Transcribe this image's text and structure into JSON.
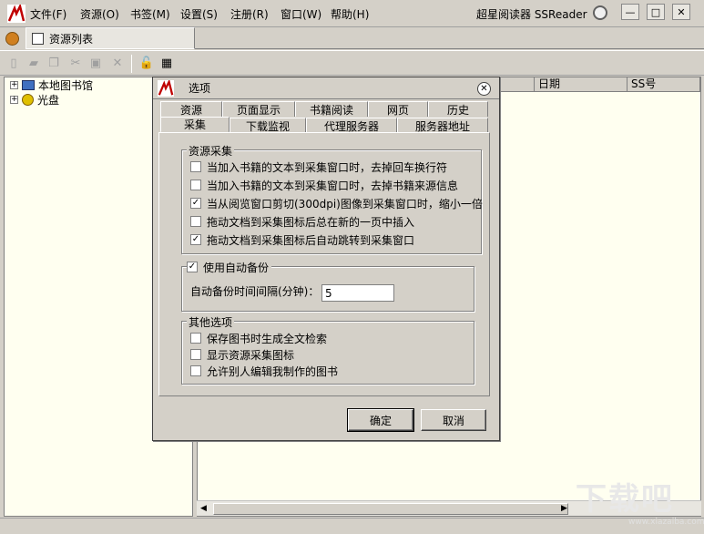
{
  "menubar": {
    "items": [
      {
        "label": "文件(F)"
      },
      {
        "label": "资源(O)"
      },
      {
        "label": "书签(M)"
      },
      {
        "label": "设置(S)"
      },
      {
        "label": "注册(R)"
      },
      {
        "label": "窗口(W)"
      },
      {
        "label": "帮助(H)"
      }
    ],
    "app_title": "超星阅读器 SSReader"
  },
  "doc_tab": {
    "label": "资源列表"
  },
  "tree": {
    "items": [
      {
        "label": "本地图书馆"
      },
      {
        "label": "光盘"
      }
    ]
  },
  "list": {
    "columns": [
      {
        "label": "日期"
      },
      {
        "label": "SS号"
      }
    ]
  },
  "dialog": {
    "title": "选项",
    "tabs_row1": [
      {
        "label": "资源"
      },
      {
        "label": "页面显示"
      },
      {
        "label": "书籍阅读"
      },
      {
        "label": "网页"
      },
      {
        "label": "历史"
      }
    ],
    "tabs_row2": [
      {
        "label": "采集"
      },
      {
        "label": "下载监视"
      },
      {
        "label": "代理服务器"
      },
      {
        "label": "服务器地址"
      }
    ],
    "group_collect": {
      "title": "资源采集",
      "options": [
        {
          "label": "当加入书籍的文本到采集窗口时，去掉回车换行符",
          "checked": "false"
        },
        {
          "label": "当加入书籍的文本到采集窗口时，去掉书籍来源信息",
          "checked": "false"
        },
        {
          "label": "当从阅览窗口剪切(300dpi)图像到采集窗口时，缩小一倍",
          "checked": "true"
        },
        {
          "label": "拖动文档到采集图标后总在新的一页中插入",
          "checked": "false"
        },
        {
          "label": "拖动文档到采集图标后自动跳转到采集窗口",
          "checked": "true"
        }
      ]
    },
    "group_backup": {
      "title": "使用自动备份",
      "checked": "true",
      "interval_label": "自动备份时间间隔(分钟)：",
      "interval_value": "5"
    },
    "group_other": {
      "title": "其他选项",
      "options": [
        {
          "label": "保存图书时生成全文检索",
          "checked": "false"
        },
        {
          "label": "显示资源采集图标",
          "checked": "false"
        },
        {
          "label": "允许别人编辑我制作的图书",
          "checked": "false"
        }
      ]
    },
    "ok_label": "确定",
    "cancel_label": "取消"
  },
  "watermark": {
    "text": "下载吧",
    "url": "www.xiazaiba.com"
  }
}
